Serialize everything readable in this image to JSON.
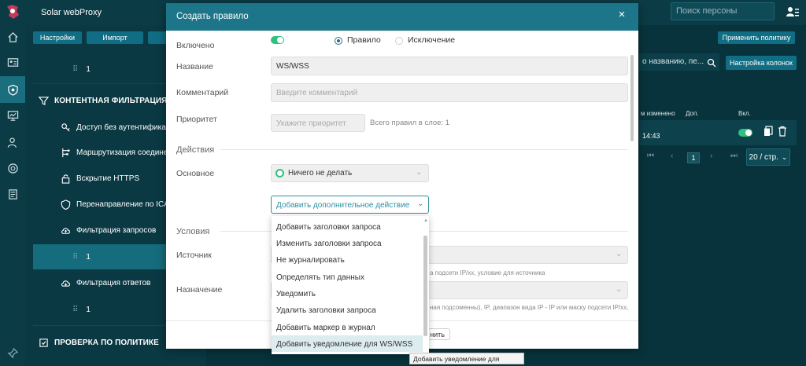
{
  "app": {
    "title": "Solar webProxy"
  },
  "header": {
    "search_placeholder": "Поиск персоны"
  },
  "toolbar": {
    "settings_label": "Настройки",
    "import_label": "Импорт",
    "apply_policy_label": "Применить политику"
  },
  "tree": {
    "items": [
      {
        "label": "1",
        "kind": "sub"
      },
      {
        "label": "КОНТЕНТНАЯ ФИЛЬТРАЦИЯ",
        "kind": "section"
      },
      {
        "label": "Доступ без аутентификации",
        "kind": "item"
      },
      {
        "label": "Маршрутизация соединений",
        "kind": "item"
      },
      {
        "label": "Вскрытие HTTPS",
        "kind": "item"
      },
      {
        "label": "Перенаправление по ICAP",
        "kind": "item"
      },
      {
        "label": "Фильтрация запросов",
        "kind": "item"
      },
      {
        "label": "1",
        "kind": "sub"
      },
      {
        "label": "Фильтрация ответов",
        "kind": "item"
      },
      {
        "label": "1",
        "kind": "sub"
      },
      {
        "label": "ПРОВЕРКА ПО ПОЛИТИКЕ",
        "kind": "section"
      }
    ]
  },
  "rules_table": {
    "search_text": "о названию, пе...",
    "columns_button": "Настройка колонок",
    "headers": {
      "changed": "м изменено",
      "extra": "Доп.",
      "enabled": "Вкл."
    },
    "row": {
      "time": "14:43",
      "enabled": true
    },
    "pager": {
      "page": "1",
      "per_page": "20 / стр."
    }
  },
  "modal": {
    "title": "Создать правило",
    "close": "×",
    "enabled_label": "Включено",
    "enabled": true,
    "type_options": [
      {
        "label": "Правило",
        "selected": true
      },
      {
        "label": "Исключение",
        "selected": false
      }
    ],
    "name_label": "Название",
    "name_value": "WS/WSS",
    "comment_label": "Комментарий",
    "comment_placeholder": "Введите комментарий",
    "priority_label": "Приоритет",
    "priority_placeholder": "Укажите приоритет",
    "priority_hint": "Всего правил в слое: 1",
    "actions_section": "Действия",
    "main_label": "Основное",
    "main_value": "Ничего не делать",
    "add_action_placeholder": "Добавить дополнительное действие",
    "conditions_section": "Условия",
    "source_label": "Источник",
    "source_hint": "а подсети IP/xx, условие для источника",
    "destination_label": "Назначение",
    "destination_hint": "ная подсоменны), IP, диапазон вида IP - IP или маску подсети IP/xx,",
    "footer_button_fragment": "нить"
  },
  "dropdown": {
    "options": [
      "Добавить заголовки запроса",
      "Изменить заголовки запроса",
      "Не журналировать",
      "Определять тип данных",
      "Уведомить",
      "Удалить заголовки запроса",
      "Добавить маркер в журнал",
      "Добавить уведомление для WS/WSS"
    ],
    "highlighted_index": 7
  },
  "tooltip": {
    "text": "Добавить уведомление для WS/WSS"
  },
  "colors": {
    "header_teal": "#1c7589",
    "nav_bg": "#0b3c46",
    "accent_green": "#2ec27e",
    "button_teal": "#116d83"
  }
}
